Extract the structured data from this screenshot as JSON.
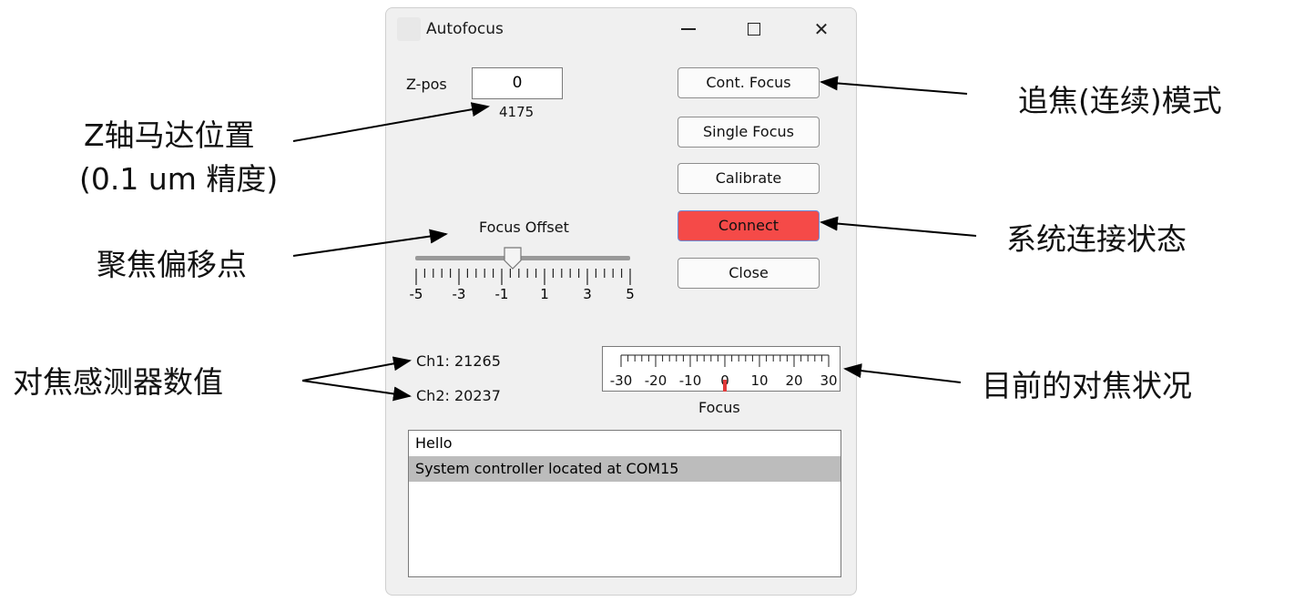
{
  "window": {
    "title": "Autofocus",
    "controls": {
      "minimize": "minimize-icon",
      "maximize": "maximize-icon",
      "close": "close-icon",
      "close_glyph": "✕"
    }
  },
  "zpos": {
    "label": "Z-pos",
    "value": "0",
    "reading": "4175"
  },
  "buttons": {
    "cont_focus": "Cont. Focus",
    "single_focus": "Single Focus",
    "calibrate": "Calibrate",
    "connect": "Connect",
    "close": "Close"
  },
  "focus_offset": {
    "label": "Focus Offset",
    "min": -5,
    "max": 5,
    "value": -0.5,
    "tick_labels": [
      "-5",
      "-3",
      "-1",
      "1",
      "3",
      "5"
    ]
  },
  "sensors": {
    "ch1": "Ch1: 21265",
    "ch2": "Ch2: 20237"
  },
  "focus_gauge": {
    "label": "Focus",
    "min": -30,
    "max": 30,
    "value": 0,
    "tick_labels": [
      "-30",
      "-20",
      "-10",
      "0",
      "10",
      "20",
      "30"
    ],
    "indicator_color": "#e03a3a"
  },
  "log": {
    "items": [
      "Hello",
      "System controller located at COM15"
    ],
    "selected_index": 1
  },
  "annotations": {
    "cont_focus_mode": "追焦(连续)模式",
    "z_motor_position_line1": "Z轴马达位置",
    "z_motor_position_line2": "(0.1 um 精度)",
    "focus_offset_point": "聚焦偏移点",
    "connection_status": "系统连接状态",
    "sensor_values": "对焦感测器数值",
    "current_focus_status": "目前的对焦状况"
  },
  "colors": {
    "connect_button": "#f54a48",
    "window_bg": "#f0f0f0"
  }
}
